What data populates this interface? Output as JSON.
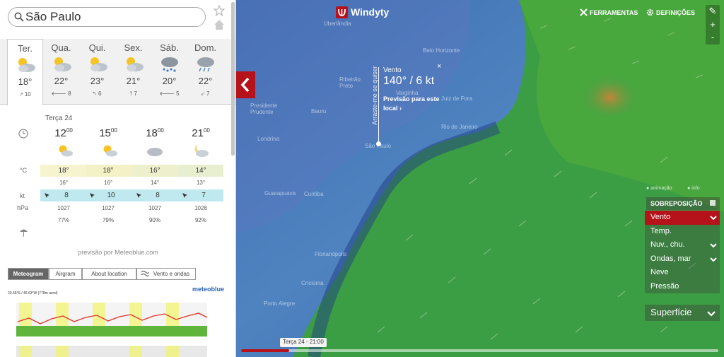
{
  "search": {
    "value": "São Paulo",
    "placeholder": ""
  },
  "days": [
    {
      "name": "Ter.",
      "temp": "18°",
      "wind": "10",
      "icon": "partly-cloudy-icon",
      "active": true
    },
    {
      "name": "Qua.",
      "temp": "22°",
      "wind": "8",
      "icon": "partly-cloudy-icon"
    },
    {
      "name": "Qui.",
      "temp": "23°",
      "wind": "6",
      "icon": "partly-cloudy-icon"
    },
    {
      "name": "Sex.",
      "temp": "21°",
      "wind": "7",
      "icon": "partly-cloudy-icon"
    },
    {
      "name": "Sáb.",
      "temp": "20°",
      "wind": "5",
      "icon": "rain-snow-icon"
    },
    {
      "name": "Dom.",
      "temp": "22°",
      "wind": "7",
      "icon": "cloudy-rain-icon"
    }
  ],
  "detail": {
    "date": "Terça 24",
    "hours": [
      {
        "h": "12",
        "m": "00",
        "temp": "18°",
        "temp2": "16°",
        "wind": "8",
        "pressure": "1027",
        "humidity": "77%",
        "icon": "sun-cloud-icon"
      },
      {
        "h": "15",
        "m": "00",
        "temp": "18°",
        "temp2": "16°",
        "wind": "10",
        "pressure": "1027",
        "humidity": "79%",
        "icon": "sun-cloud-icon"
      },
      {
        "h": "18",
        "m": "00",
        "temp": "16°",
        "temp2": "14°",
        "wind": "8",
        "pressure": "1027",
        "humidity": "90%",
        "icon": "cloud-icon"
      },
      {
        "h": "21",
        "m": "00",
        "temp": "14°",
        "temp2": "13°",
        "wind": "7",
        "pressure": "1028",
        "humidity": "92%",
        "icon": "moon-cloud-icon"
      }
    ],
    "labels": {
      "temp": "°C",
      "wind": "kt",
      "pressure": "hPa"
    },
    "credit": "previsão por Meteoblue.com"
  },
  "subtabs": [
    "Meteogram",
    "Airgram",
    "About location",
    "Vento e ondas"
  ],
  "meteogram": {
    "coords": "23.55°S / 46.63°W (778m asml)",
    "brand": "meteoblue"
  },
  "map": {
    "brand": "Windyty",
    "tools": "FERRAMENTAS",
    "settings": "DEFINIÇÕES",
    "zoom_in": "+",
    "zoom_out": "-",
    "cities": [
      "Uberlândia",
      "Belo Horizonte",
      "Ribeirão Preto",
      "Presidente Prudente",
      "Bauru",
      "Londrina",
      "Curitiba",
      "Guarapuava",
      "Florianópolis",
      "Criciúma",
      "Porto Alegre",
      "Varginha",
      "Juiz de Fora",
      "Rio de Janeiro",
      "São Paulo"
    ],
    "popup": {
      "title": "Vento",
      "value": "140° / 6 kt",
      "forecast": "Previsão para este local",
      "drag": "Arraste-me se quiser",
      "close": "×"
    },
    "animation": "animação",
    "info": "info",
    "overlay_title": "SOBREPOSIÇÃO",
    "overlays": [
      "Vento",
      "Temp.",
      "Nuv., chu.",
      "Ondas, mar",
      "Neve",
      "Pressão"
    ],
    "surface": "Superfície",
    "time": "Terça 24 - 21:00",
    "timeline_progress": 0.1
  },
  "colors": {
    "accent": "#b5121b",
    "temp_bar": "#f5f1c2",
    "wind_bar": "#bfe9ef"
  }
}
